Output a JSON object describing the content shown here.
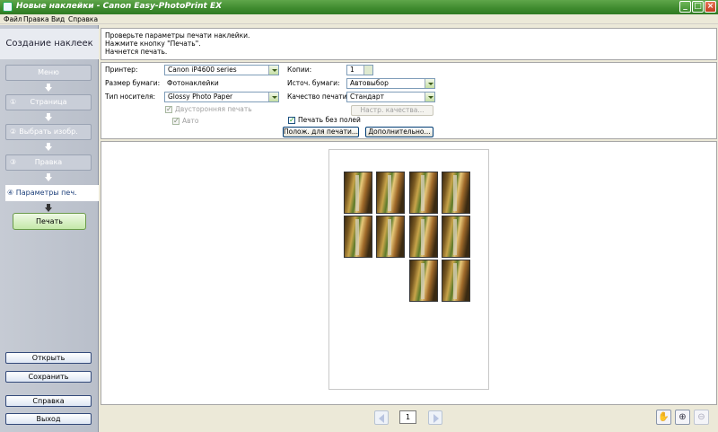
{
  "window": {
    "title": "Новые наклейки - Canon Easy-PhotoPrint EX",
    "minimize": "_",
    "maximize": "□",
    "close": "×"
  },
  "menu": [
    "Файл",
    "Правка",
    "Вид",
    "Справка"
  ],
  "sidebar": {
    "title": "Создание наклеек",
    "steps": [
      {
        "num": "",
        "label": "Меню"
      },
      {
        "num": "①",
        "label": "Страница"
      },
      {
        "num": "②",
        "label": "Выбрать изобр."
      },
      {
        "num": "③",
        "label": "Правка"
      }
    ],
    "active_step": "④ Параметры печ.",
    "print_button": "Печать",
    "open_button": "Открыть",
    "save_button": "Сохранить",
    "help_button": "Справка",
    "exit_button": "Выход"
  },
  "info": {
    "line1": "Проверьте параметры печати наклейки.",
    "line2": "Нажмите кнопку \"Печать\".",
    "line3": "Начнется печать."
  },
  "settings": {
    "printer_label": "Принтер:",
    "printer_value": "Canon iP4600 series",
    "paper_size_label": "Размер бумаги:",
    "paper_size_value": "Фотонаклейки",
    "media_label": "Тип носителя:",
    "media_value": "Glossy Photo Paper",
    "duplex_label": "Двусторонняя печать",
    "auto_label": "Авто",
    "copies_label": "Копии:",
    "copies_value": "1",
    "source_label": "Источ. бумаги:",
    "source_value": "Автовыбор",
    "quality_label": "Качество печати:",
    "quality_value": "Стандарт",
    "quality_settings_button": "Настр. качества...",
    "borderless_label": "Печать без полей",
    "print_position_button": "Полож. для печати...",
    "advanced_button": "Дополнительно..."
  },
  "preview": {
    "sticker_count": 10,
    "page_number": "1"
  },
  "toolbar": {
    "hand_icon": "hand-icon",
    "zoom_in_icon": "zoom-in-icon",
    "zoom_out_icon": "zoom-out-icon"
  }
}
